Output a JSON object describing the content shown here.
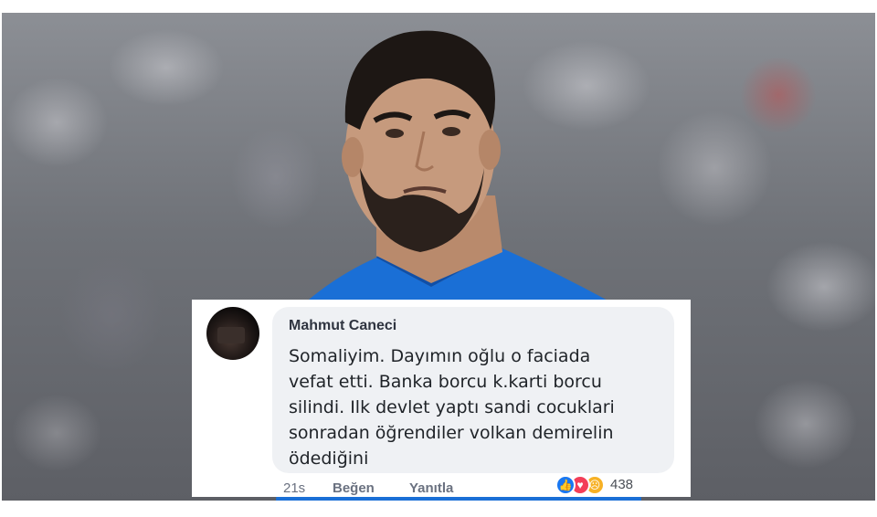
{
  "comment": {
    "author": "Mahmut Caneci",
    "lines": [
      "Somaliyim. Dayımın oğlu o faciada",
      "vefat etti. Banka borcu k.karti borcu",
      "silindi. Ilk devlet yaptı sandi cocuklari",
      "sonradan öğrendiler volkan demirelin",
      "ödediğini"
    ],
    "time": "21s",
    "like_label": "Beğen",
    "reply_label": "Yanıtla",
    "reaction_count": "438",
    "reactions": [
      "like-icon",
      "love-icon",
      "sad-icon"
    ]
  },
  "colors": {
    "like": "#1877f2",
    "love": "#f33e58",
    "sad": "#f7b125",
    "jersey": "#1a6fd6"
  }
}
